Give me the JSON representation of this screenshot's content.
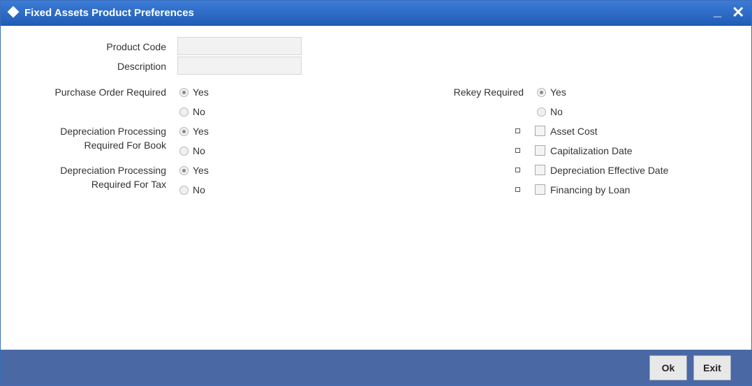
{
  "window": {
    "title": "Fixed Assets Product Preferences",
    "minimize_label": "_",
    "close_label": "✕"
  },
  "fields": {
    "product_code": {
      "label": "Product Code",
      "value": ""
    },
    "description": {
      "label": "Description",
      "value": ""
    }
  },
  "left_options": {
    "purchase_order": {
      "label": "Purchase Order Required",
      "yes": "Yes",
      "no": "No",
      "selected": "Yes"
    },
    "dep_book": {
      "label_line1": "Depreciation Processing",
      "label_line2": "Required For Book",
      "yes": "Yes",
      "no": "No",
      "selected": "Yes"
    },
    "dep_tax": {
      "label_line1": "Depreciation Processing",
      "label_line2": "Required For Tax",
      "yes": "Yes",
      "no": "No",
      "selected": "Yes"
    }
  },
  "right_options": {
    "rekey": {
      "label": "Rekey Required",
      "yes": "Yes",
      "no": "No",
      "selected": "Yes"
    },
    "checkboxes": [
      {
        "label": "Asset Cost",
        "checked": false
      },
      {
        "label": "Capitalization Date",
        "checked": false
      },
      {
        "label": "Depreciation Effective Date",
        "checked": false
      },
      {
        "label": "Financing by Loan",
        "checked": false
      }
    ]
  },
  "footer": {
    "ok_label": "Ok",
    "exit_label": "Exit"
  }
}
